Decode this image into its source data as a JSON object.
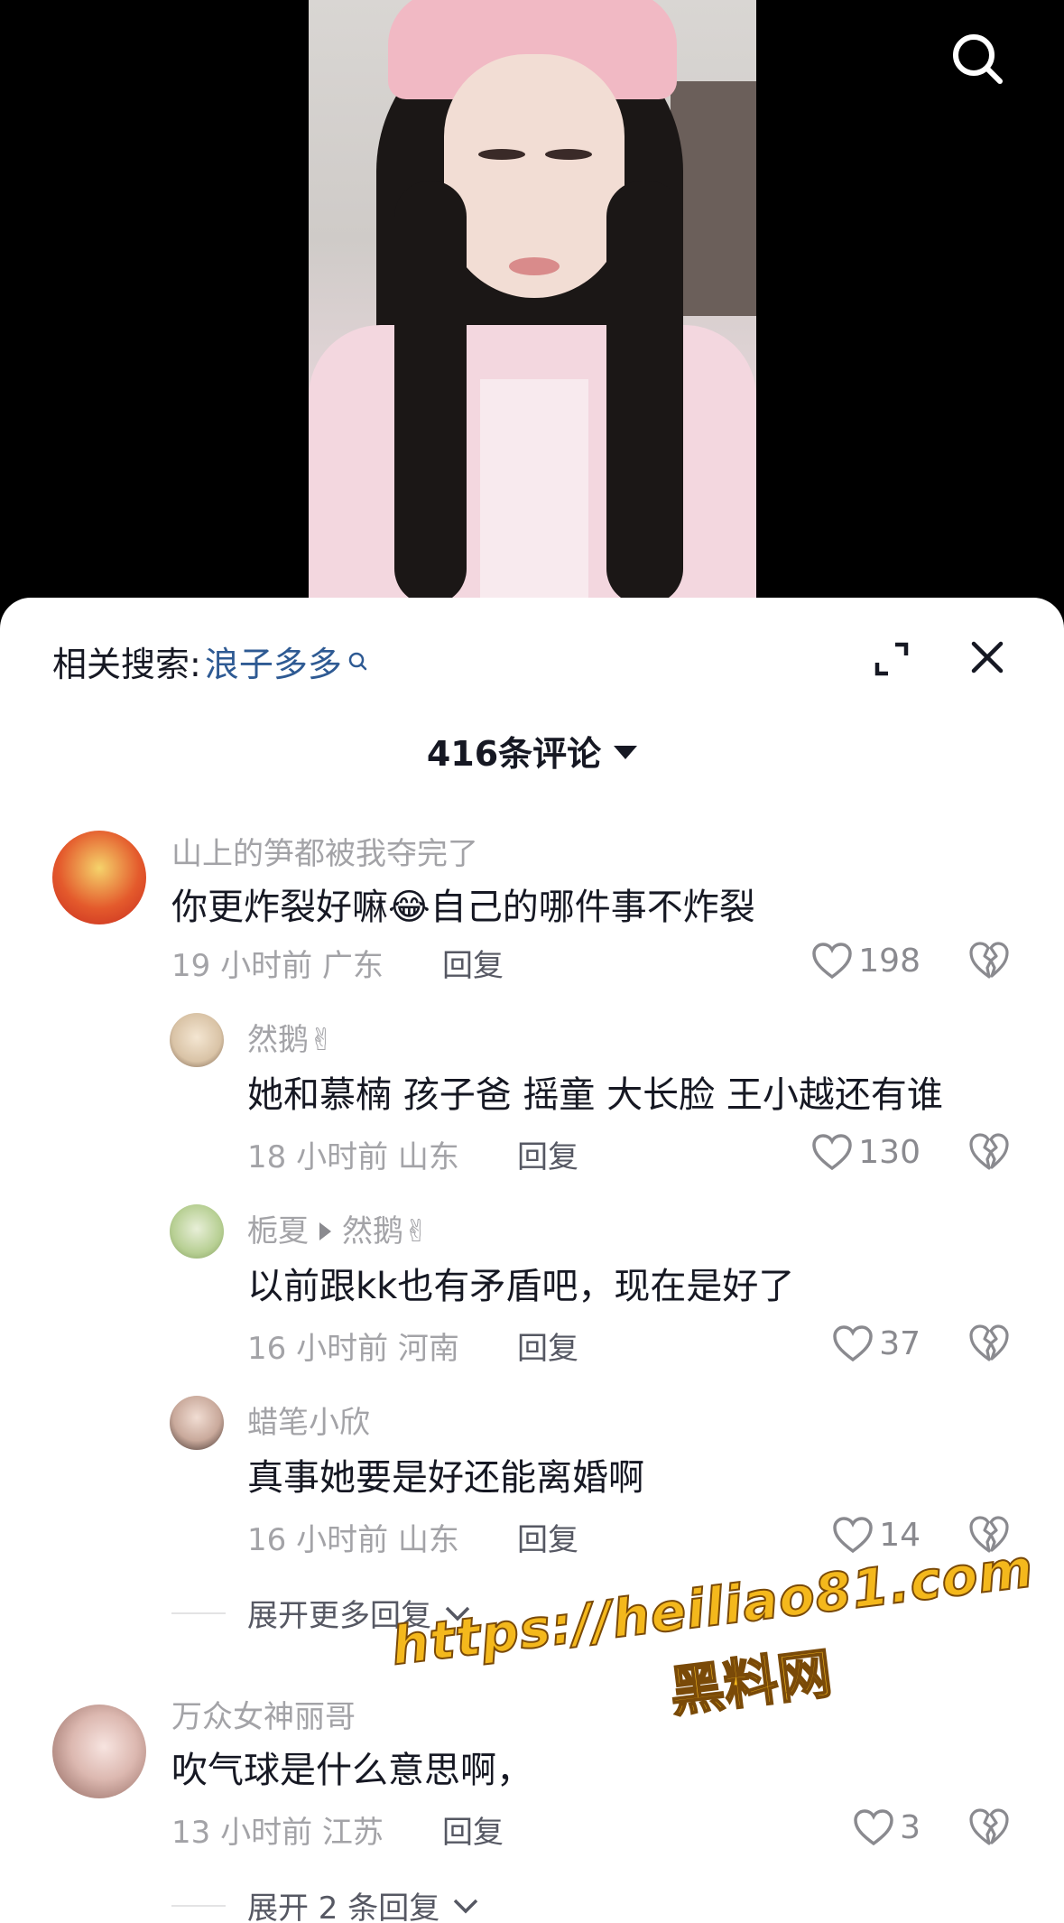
{
  "icons": {
    "search": "search-icon",
    "expand": "expand-icon",
    "close": "close-icon",
    "like": "heart-icon",
    "dislike": "broken-heart-icon"
  },
  "colors": {
    "link": "#2e5a93",
    "muted": "#a3a3a7",
    "text": "#161823",
    "watermark": "#f4b81c"
  },
  "related_search": {
    "label": "相关搜索:",
    "keyword": "浪子多多"
  },
  "comment_count": "416条评论",
  "comments": [
    {
      "user": "山上的笋都被我夺完了",
      "text_before": "你更炸裂好嘛",
      "emoji": "😂",
      "text_after": "自己的哪件事不炸裂",
      "time": "19 小时前",
      "location": "广东",
      "reply": "回复",
      "likes": "198"
    },
    {
      "user": "然鹅✌",
      "text": "她和慕楠 孩子爸 摇童 大长脸 王小越还有谁",
      "time": "18 小时前",
      "location": "山东",
      "reply": "回复",
      "likes": "130"
    },
    {
      "user": "栀夏",
      "reply_to": "然鹅✌",
      "text": "以前跟kk也有矛盾吧，现在是好了",
      "time": "16 小时前",
      "location": "河南",
      "reply": "回复",
      "likes": "37"
    },
    {
      "user": "蜡笔小欣",
      "text": "真事她要是好还能离婚啊",
      "time": "16 小时前",
      "location": "山东",
      "reply": "回复",
      "likes": "14"
    },
    {
      "user": "万众女神丽哥",
      "text": "吹气球是什么意思啊，",
      "time": "13 小时前",
      "location": "江苏",
      "reply": "回复",
      "likes": "3"
    }
  ],
  "expand_more": "展开更多回复",
  "expand_two": "展开 2 条回复",
  "watermark": {
    "url": "https://heiliao81.com",
    "name": "黑料网"
  }
}
